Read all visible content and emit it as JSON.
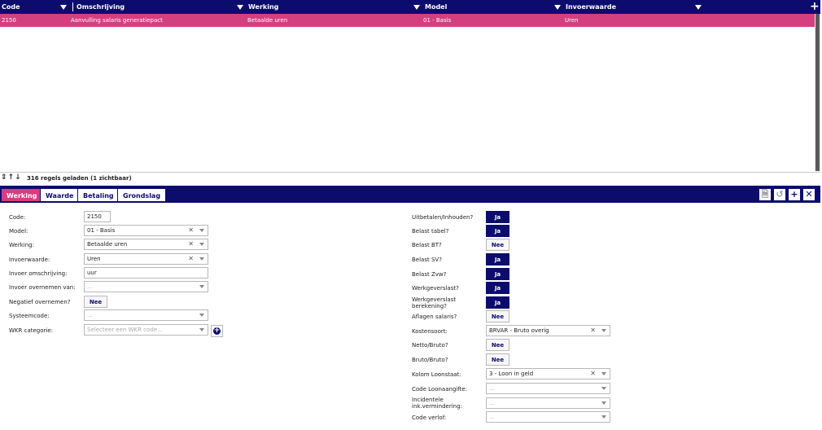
{
  "grid": {
    "columns": [
      "Code",
      "Omschrijving",
      "Werking",
      "Model",
      "Invoerwaarde"
    ],
    "add_icon": "plus-icon",
    "rows": [
      {
        "code": "2150",
        "omschrijving": "Aanvulling salaris generatiepact",
        "werking": "Betaalde uren",
        "model": "01 - Basis",
        "invoerwaarde": "Uren"
      }
    ]
  },
  "status": {
    "icons": "⇕↑↓",
    "text": "316 regels geladen (1 zichtbaar)"
  },
  "tabs": [
    "Werking",
    "Waarde",
    "Betaling",
    "Grondslag"
  ],
  "toolbar": {
    "save": "🗎",
    "undo": "↺",
    "add": "+",
    "close": "✕"
  },
  "form_left": {
    "code": {
      "label": "Code:",
      "value": "2150"
    },
    "model": {
      "label": "Model:",
      "value": "01 - Basis"
    },
    "werking": {
      "label": "Werking:",
      "value": "Betaalde uren"
    },
    "invoerwaarde": {
      "label": "Invoerwaarde:",
      "value": "Uren"
    },
    "invoer_omschrijving": {
      "label": "Invoer omschrijving:",
      "value": "uur"
    },
    "invoer_overnemen_van": {
      "label": "Invoer overnemen van:",
      "placeholder": "..."
    },
    "negatief_overnemen": {
      "label": "Negatief overnemen?",
      "value": "Nee"
    },
    "systeemcode": {
      "label": "Systeemcode:",
      "placeholder": "..."
    },
    "wkr_categorie": {
      "label": "WKR categorie:",
      "placeholder": "Selecteer een WKR code..."
    }
  },
  "form_right": {
    "uitbetalen": {
      "label": "Uitbetalen/Inhouden?",
      "value": "Ja"
    },
    "belast_tabel": {
      "label": "Belast tabel?",
      "value": "Ja"
    },
    "belast_bt": {
      "label": "Belast BT?",
      "value": "Nee"
    },
    "belast_sv": {
      "label": "Belast SV?",
      "value": "Ja"
    },
    "belast_zvw": {
      "label": "Belast Zvw?",
      "value": "Ja"
    },
    "werkgeverslast": {
      "label": "Werkgeverslast?",
      "value": "Ja"
    },
    "werkgeverslast_berekening": {
      "label1": "Werkgeverslast",
      "label2": "berekening?",
      "value": "Ja"
    },
    "aflagen_salaris": {
      "label": "Aflagen salaris?",
      "value": "Nee"
    },
    "kostensoort": {
      "label": "Kostensoort:",
      "value": "BRVAR - Bruto overig"
    },
    "netto_bruto": {
      "label": "Netto/Bruto?",
      "value": "Nee"
    },
    "bruto_bruto": {
      "label": "Bruto/Bruto?",
      "value": "Nee"
    },
    "kolom_loonstaat": {
      "label": "Kolom Loonstaat:",
      "value": "3 - Loon in geld"
    },
    "code_loonaangifte": {
      "label": "Code Loonaangifte:",
      "placeholder": "..."
    },
    "incidentele": {
      "label1": "Incidentele",
      "label2": "ink.vermindering:",
      "placeholder": "..."
    },
    "code_verlof": {
      "label": "Code verlof:",
      "placeholder": "..."
    }
  },
  "colors": {
    "navy": "#0c0c6e",
    "pink": "#d43f7f"
  }
}
